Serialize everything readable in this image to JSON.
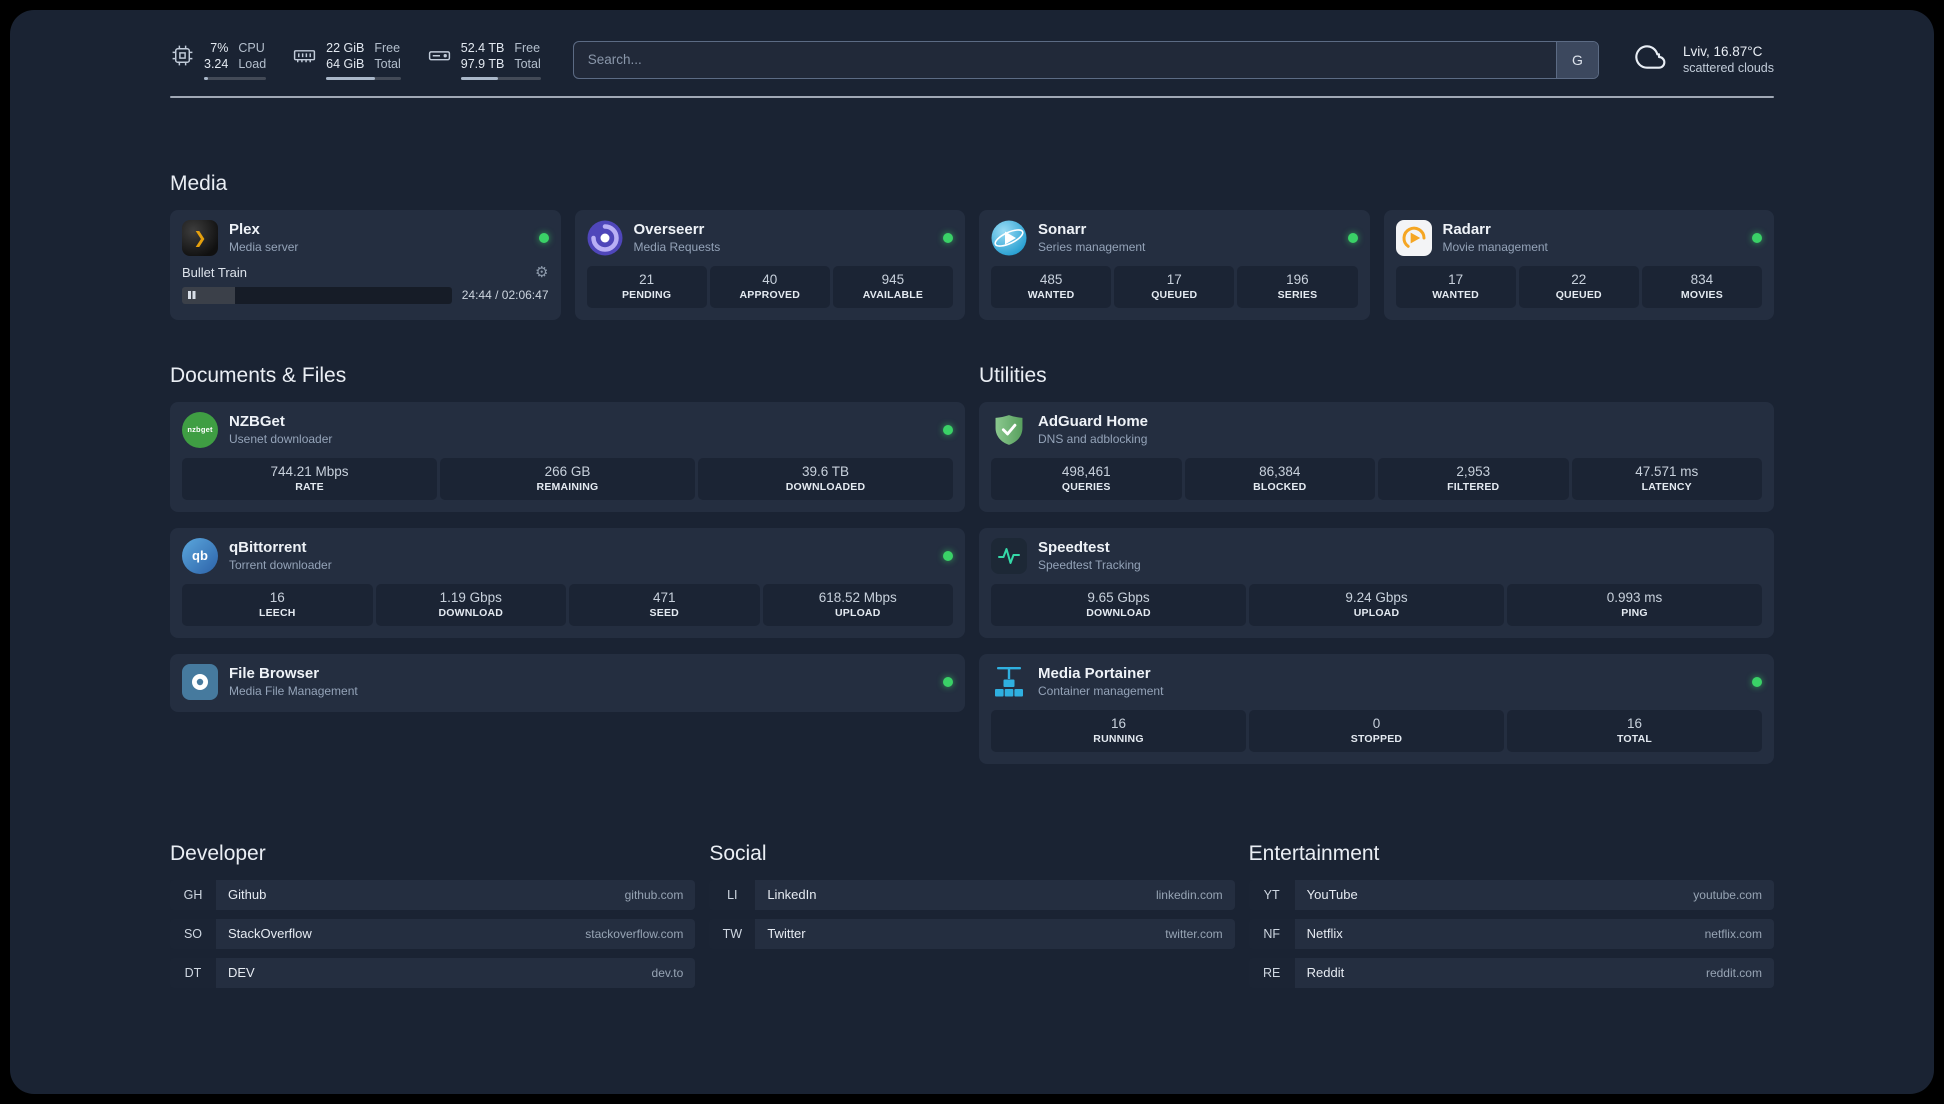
{
  "colors": {
    "background": "#1a2333",
    "card": "#242e40",
    "stat_box": "#1b2434",
    "status_online": "#3ad167",
    "plex_accent": "#e5a00d",
    "adguard_green": "#6cb672",
    "portainer_blue": "#2fb0e0"
  },
  "topbar": {
    "resources": [
      {
        "icon": "cpu-icon",
        "value1": "7%",
        "value2": "3.24",
        "label1": "CPU",
        "label2": "Load",
        "bar_percent": 7
      },
      {
        "icon": "memory-icon",
        "value1": "22 GiB",
        "value2": "64 GiB",
        "label1": "Free",
        "label2": "Total",
        "bar_percent": 66
      },
      {
        "icon": "disk-icon",
        "value1": "52.4 TB",
        "value2": "97.9 TB",
        "label1": "Free",
        "label2": "Total",
        "bar_percent": 47
      }
    ],
    "search": {
      "placeholder": "Search...",
      "provider": "G"
    },
    "weather": {
      "location": "Lviv, 16.87°C",
      "condition": "scattered clouds"
    }
  },
  "icon_text": {
    "plex": "❯",
    "qbittorrent": "qb",
    "nzbget": "nzbget"
  },
  "media": {
    "title": "Media",
    "cards": [
      {
        "name": "Plex",
        "desc": "Media server",
        "status": "online",
        "player": {
          "title": "Bullet Train",
          "time": "24:44 / 02:06:47",
          "progress_percent": 19.5
        }
      },
      {
        "name": "Overseerr",
        "desc": "Media Requests",
        "status": "online",
        "stats": [
          {
            "value": "21",
            "label": "PENDING"
          },
          {
            "value": "40",
            "label": "APPROVED"
          },
          {
            "value": "945",
            "label": "AVAILABLE"
          }
        ]
      },
      {
        "name": "Sonarr",
        "desc": "Series management",
        "status": "online",
        "stats": [
          {
            "value": "485",
            "label": "WANTED"
          },
          {
            "value": "17",
            "label": "QUEUED"
          },
          {
            "value": "196",
            "label": "SERIES"
          }
        ]
      },
      {
        "name": "Radarr",
        "desc": "Movie management",
        "status": "online",
        "stats": [
          {
            "value": "17",
            "label": "WANTED"
          },
          {
            "value": "22",
            "label": "QUEUED"
          },
          {
            "value": "834",
            "label": "MOVIES"
          }
        ]
      }
    ]
  },
  "documents": {
    "title": "Documents & Files",
    "cards": [
      {
        "name": "NZBGet",
        "desc": "Usenet downloader",
        "status": "online",
        "stats": [
          {
            "value": "744.21 Mbps",
            "label": "RATE"
          },
          {
            "value": "266 GB",
            "label": "REMAINING"
          },
          {
            "value": "39.6 TB",
            "label": "DOWNLOADED"
          }
        ]
      },
      {
        "name": "qBittorrent",
        "desc": "Torrent downloader",
        "status": "online",
        "stats": [
          {
            "value": "16",
            "label": "LEECH"
          },
          {
            "value": "1.19 Gbps",
            "label": "DOWNLOAD"
          },
          {
            "value": "471",
            "label": "SEED"
          },
          {
            "value": "618.52 Mbps",
            "label": "UPLOAD"
          }
        ]
      },
      {
        "name": "File Browser",
        "desc": "Media File Management",
        "status": "online"
      }
    ]
  },
  "utilities": {
    "title": "Utilities",
    "cards": [
      {
        "name": "AdGuard Home",
        "desc": "DNS and adblocking",
        "stats": [
          {
            "value": "498,461",
            "label": "QUERIES"
          },
          {
            "value": "86,384",
            "label": "BLOCKED"
          },
          {
            "value": "2,953",
            "label": "FILTERED"
          },
          {
            "value": "47.571 ms",
            "label": "LATENCY"
          }
        ]
      },
      {
        "name": "Speedtest",
        "desc": "Speedtest Tracking",
        "stats": [
          {
            "value": "9.65 Gbps",
            "label": "DOWNLOAD"
          },
          {
            "value": "9.24 Gbps",
            "label": "UPLOAD"
          },
          {
            "value": "0.993 ms",
            "label": "PING"
          }
        ]
      },
      {
        "name": "Media Portainer",
        "desc": "Container management",
        "status": "online",
        "stats": [
          {
            "value": "16",
            "label": "RUNNING"
          },
          {
            "value": "0",
            "label": "STOPPED"
          },
          {
            "value": "16",
            "label": "TOTAL"
          }
        ]
      }
    ]
  },
  "bookmarks": [
    {
      "title": "Developer",
      "items": [
        {
          "abbr": "GH",
          "name": "Github",
          "domain": "github.com"
        },
        {
          "abbr": "SO",
          "name": "StackOverflow",
          "domain": "stackoverflow.com"
        },
        {
          "abbr": "DT",
          "name": "DEV",
          "domain": "dev.to"
        }
      ]
    },
    {
      "title": "Social",
      "items": [
        {
          "abbr": "LI",
          "name": "LinkedIn",
          "domain": "linkedin.com"
        },
        {
          "abbr": "TW",
          "name": "Twitter",
          "domain": "twitter.com"
        }
      ]
    },
    {
      "title": "Entertainment",
      "items": [
        {
          "abbr": "YT",
          "name": "YouTube",
          "domain": "youtube.com"
        },
        {
          "abbr": "NF",
          "name": "Netflix",
          "domain": "netflix.com"
        },
        {
          "abbr": "RE",
          "name": "Reddit",
          "domain": "reddit.com"
        }
      ]
    }
  ]
}
